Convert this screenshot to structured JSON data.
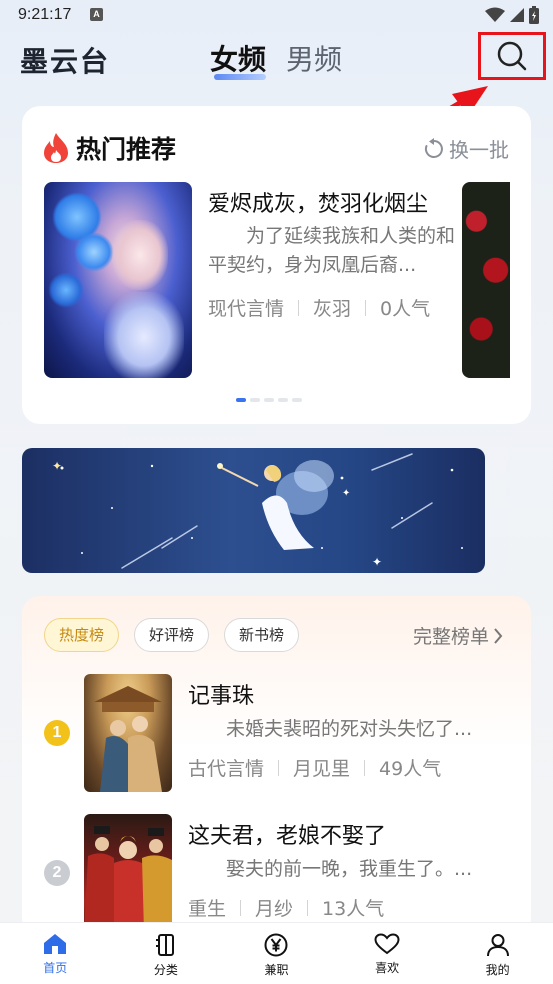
{
  "status": {
    "time": "9:21:17",
    "a_label": "A"
  },
  "header": {
    "brand": "墨云台",
    "tabs": [
      {
        "label": "女频",
        "active": true
      },
      {
        "label": "男频",
        "active": false
      }
    ],
    "search_icon": "search-icon"
  },
  "hot": {
    "title": "热门推荐",
    "refresh_label": "换一批",
    "book": {
      "title": "爱烬成灰，焚羽化烟尘",
      "desc": "为了延续我族和人类的和平契约，身为凤凰后裔...",
      "genre": "现代言情",
      "author": "灰羽",
      "popularity": "0人气"
    },
    "carousel_index": 0,
    "carousel_count": 5
  },
  "ranking": {
    "tabs": [
      {
        "label": "热度榜",
        "active": true
      },
      {
        "label": "好评榜",
        "active": false
      },
      {
        "label": "新书榜",
        "active": false
      }
    ],
    "full_list_label": "完整榜单",
    "items": [
      {
        "rank": "1",
        "title": "记事珠",
        "desc": "未婚夫裴昭的死对头失忆了...",
        "genre": "古代言情",
        "author": "月见里",
        "popularity": "49人气"
      },
      {
        "rank": "2",
        "title": "这夫君，老娘不娶了",
        "desc": "娶夫的前一晚，我重生了。...",
        "genre": "重生",
        "author": "月纱",
        "popularity": "13人气"
      }
    ]
  },
  "nav": {
    "items": [
      {
        "label": "首页",
        "icon": "home-icon",
        "active": true
      },
      {
        "label": "分类",
        "icon": "book-icon",
        "active": false
      },
      {
        "label": "兼职",
        "icon": "yen-icon",
        "active": false
      },
      {
        "label": "喜欢",
        "icon": "heart-icon",
        "active": false
      },
      {
        "label": "我的",
        "icon": "user-icon",
        "active": false
      }
    ]
  },
  "colors": {
    "accent": "#2f6de8",
    "annotation_red": "#e8141b",
    "rank_gold": "#f2c21b",
    "rank_silver": "#c9ccd1"
  }
}
